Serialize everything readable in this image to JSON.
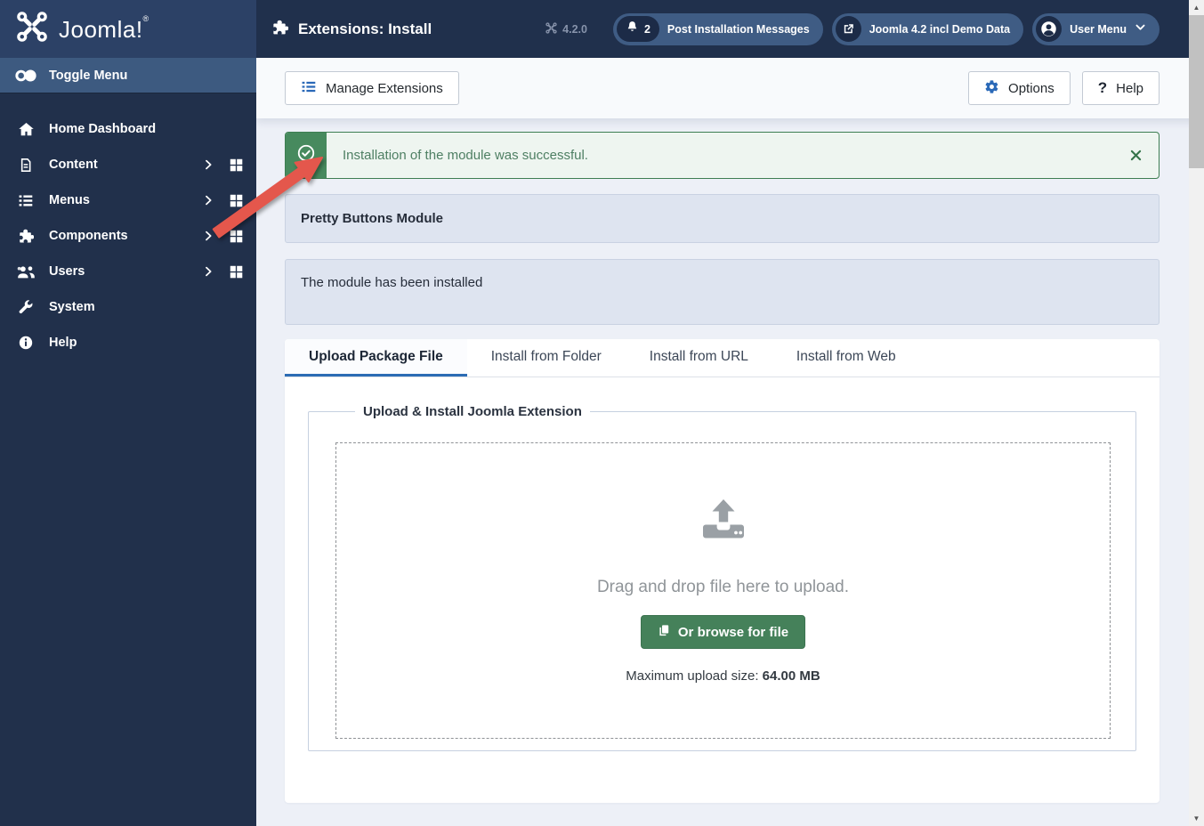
{
  "brand": {
    "logo_text": "Joomla!",
    "logo_mark": "®"
  },
  "header": {
    "title": "Extensions: Install",
    "version": "4.2.0",
    "post_installation": {
      "count": "2",
      "label": "Post Installation Messages"
    },
    "site_button": {
      "label": "Joomla 4.2 incl Demo Data"
    },
    "user_menu": {
      "label": "User Menu"
    }
  },
  "sidebar": {
    "items": [
      {
        "label": "Toggle Menu"
      },
      {
        "label": "Home Dashboard"
      },
      {
        "label": "Content"
      },
      {
        "label": "Menus"
      },
      {
        "label": "Components"
      },
      {
        "label": "Users"
      },
      {
        "label": "System"
      },
      {
        "label": "Help"
      }
    ]
  },
  "toolbar": {
    "manage_extensions": "Manage Extensions",
    "options": "Options",
    "help": "Help"
  },
  "alert": {
    "message": "Installation of the module was successful."
  },
  "install_result": {
    "module_title": "Pretty Buttons Module",
    "status_text": "The module has been installed"
  },
  "tabs": [
    {
      "label": "Upload Package File"
    },
    {
      "label": "Install from Folder"
    },
    {
      "label": "Install from URL"
    },
    {
      "label": "Install from Web"
    }
  ],
  "upload": {
    "legend": "Upload & Install Joomla Extension",
    "drag_text": "Drag and drop file here to upload.",
    "browse_button": "Or browse for file",
    "max_size_label": "Maximum upload size:",
    "max_size_value": "64.00 MB"
  },
  "colors": {
    "header_bg": "#20304c",
    "sidebar_bg": "#21304b",
    "sidebar_active_bg": "#3d5a80",
    "accent_blue": "#2a69b8",
    "success_green": "#45815a",
    "alert_border": "#3e7e52",
    "alert_bg": "#eef5f0",
    "panel_bg": "#dee4f0",
    "arrow_red": "#e4574c"
  }
}
